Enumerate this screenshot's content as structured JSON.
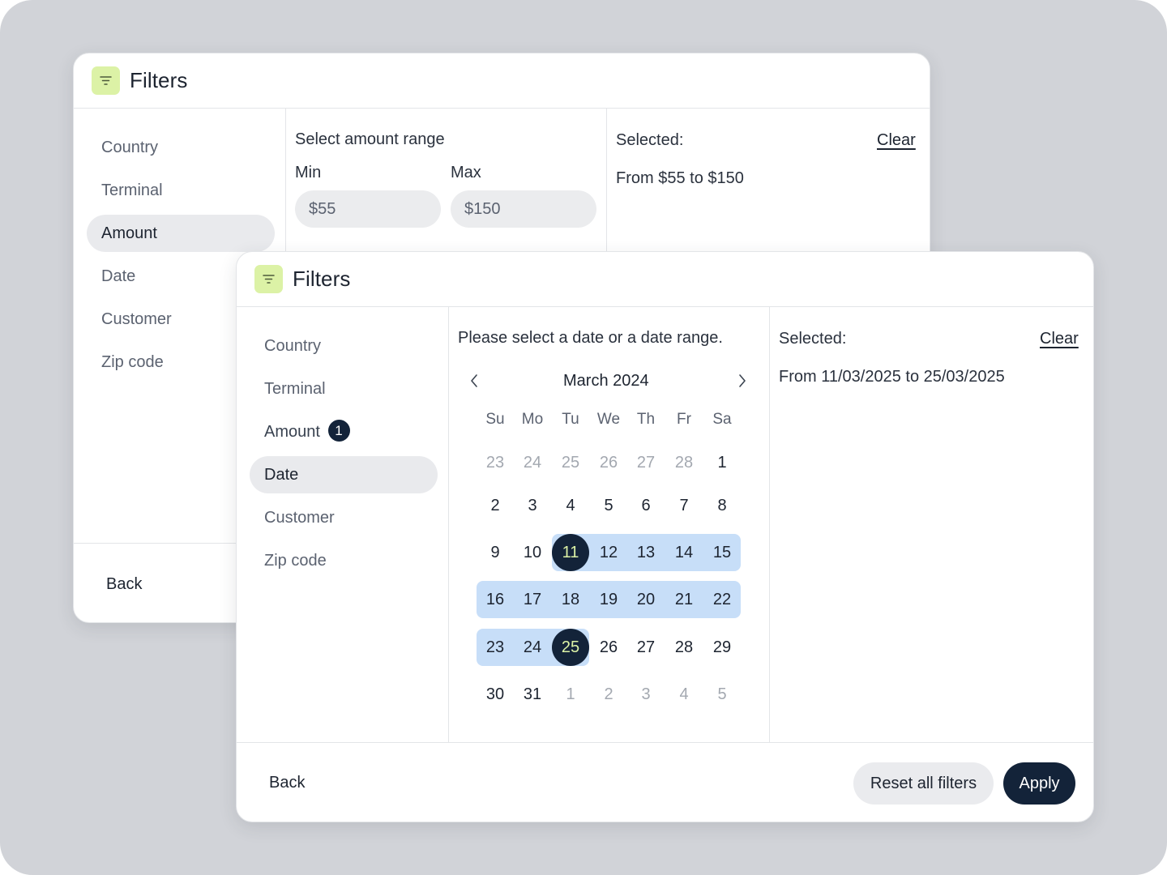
{
  "back_panel": {
    "title": "Filters",
    "nav": [
      "Country",
      "Terminal",
      "Amount",
      "Date",
      "Customer",
      "Zip code"
    ],
    "active_nav": "Amount",
    "amount": {
      "heading": "Select amount range",
      "min_label": "Min",
      "max_label": "Max",
      "min_value": "$55",
      "max_value": "$150"
    },
    "selected_label": "Selected:",
    "clear_label": "Clear",
    "selected_value": "From $55 to $150",
    "back_label": "Back"
  },
  "front_panel": {
    "title": "Filters",
    "nav": [
      "Country",
      "Terminal",
      "Amount",
      "Date",
      "Customer",
      "Zip code"
    ],
    "amount_badge": "1",
    "active_nav": "Date",
    "date_prompt": "Please select a date or a date range.",
    "calendar": {
      "month_label": "March 2024",
      "weekdays": [
        "Su",
        "Mo",
        "Tu",
        "We",
        "Th",
        "Fr",
        "Sa"
      ],
      "weeks": [
        [
          "23",
          "24",
          "25",
          "26",
          "27",
          "28",
          "1"
        ],
        [
          "2",
          "3",
          "4",
          "5",
          "6",
          "7",
          "8"
        ],
        [
          "9",
          "10",
          "11",
          "12",
          "13",
          "14",
          "15"
        ],
        [
          "16",
          "17",
          "18",
          "19",
          "20",
          "21",
          "22"
        ],
        [
          "23",
          "24",
          "25",
          "26",
          "27",
          "28",
          "29"
        ],
        [
          "30",
          "31",
          "1",
          "2",
          "3",
          "4",
          "5"
        ]
      ],
      "range_start": "11",
      "range_end": "25"
    },
    "selected_label": "Selected:",
    "clear_label": "Clear",
    "selected_value": "From 11/03/2025 to 25/03/2025",
    "back_label": "Back",
    "reset_label": "Reset all filters",
    "apply_label": "Apply"
  },
  "colors": {
    "stage_bg": "#d1d3d8",
    "accent_green": "#dcf2a6",
    "navy": "#132339",
    "range_blue": "#c7def8"
  },
  "icons": {
    "filter": "filter-lines-icon",
    "prev": "chevron-left-icon",
    "next": "chevron-right-icon"
  }
}
